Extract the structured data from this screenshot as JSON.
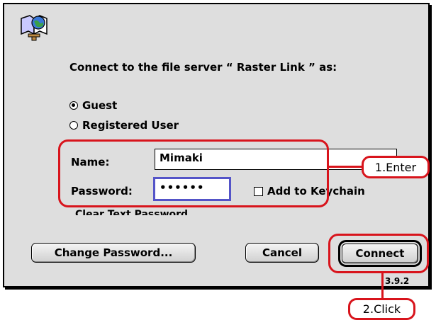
{
  "dialog": {
    "prompt": "Connect to the file server “ Raster Link ” as:",
    "options": [
      {
        "label": "Guest",
        "selected": true
      },
      {
        "label": "Registered User",
        "selected": false
      }
    ],
    "name_label": "Name:",
    "name_value": "Mimaki",
    "password_label": "Password:",
    "password_value": "••••••",
    "keychain_label": "Add to Keychain",
    "clear_text_label": "Clear Text Password",
    "change_password_button": "Change Password...",
    "cancel_button": "Cancel",
    "connect_button": "Connect",
    "version": "3.9.2"
  },
  "annotations": {
    "step1": "1.Enter",
    "step2": "2.Click",
    "color": "#d8141c"
  }
}
